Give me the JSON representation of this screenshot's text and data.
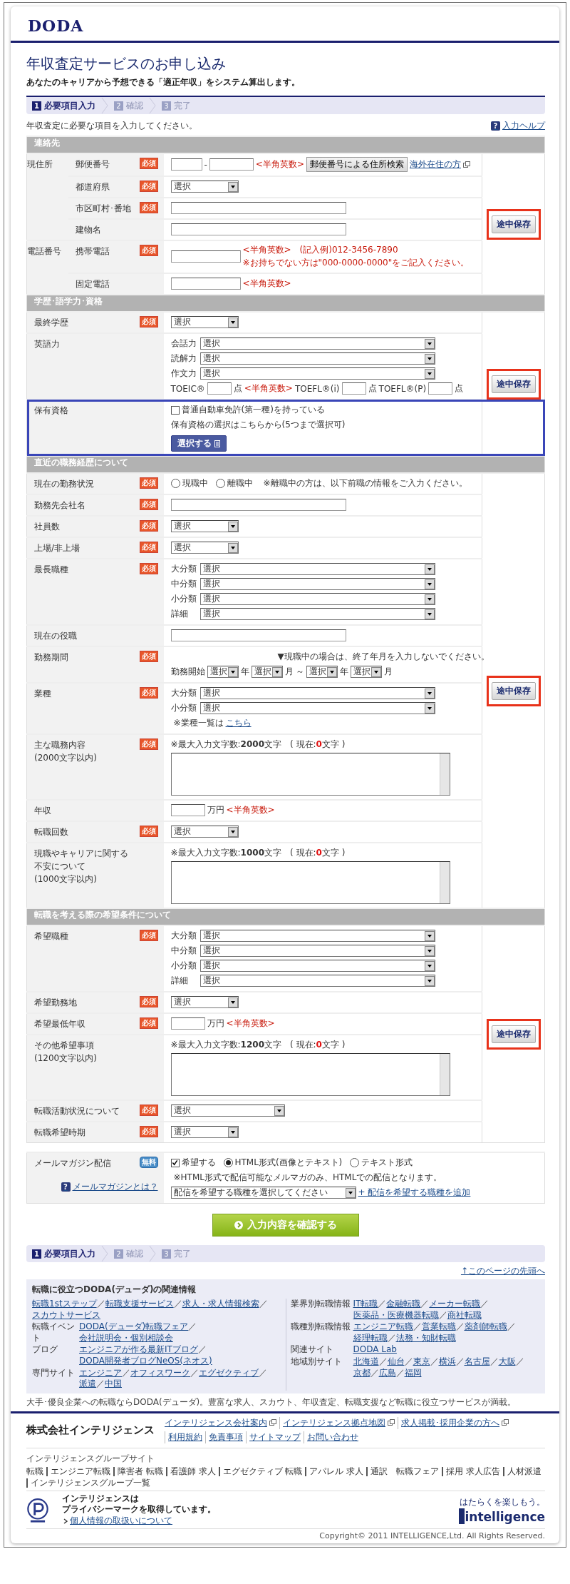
{
  "logo": "DODA",
  "title": "年収査定サービスのお申し込み",
  "subtitle": "あなたのキャリアから予想できる「適正年収」をシステム算出します。",
  "steps_top": [
    {
      "num": "1",
      "label": "必要項目入力",
      "selected": true
    },
    {
      "num": "2",
      "label": "確認",
      "selected": false
    },
    {
      "num": "3",
      "label": "完了",
      "selected": false
    }
  ],
  "intro": "年収査定に必要な項目を入力してください。",
  "help_link": {
    "icon": "?",
    "text": "入力ヘルプ"
  },
  "sections": [
    {
      "title": "連絡先",
      "save_button": "途中保存",
      "save_highlighted": true,
      "rows": [
        {
          "label": "現住所",
          "subrows": [
            {
              "label": "郵便番号",
              "badge": "必須",
              "lines": [
                {
                  "items": [
                    {
                      "kind": "input"
                    },
                    {
                      "kind": "text",
                      "text": "-"
                    },
                    {
                      "kind": "input"
                    },
                    {
                      "kind": "note",
                      "text": "<半角英数>"
                    },
                    {
                      "kind": "button",
                      "text": "郵便番号による住所検索"
                    },
                    {
                      "kind": "link",
                      "text": "海外在住の方",
                      "external": true
                    }
                  ]
                }
              ]
            },
            {
              "label": "都道府県",
              "badge": "必須",
              "lines": [
                {
                  "items": [
                    {
                      "kind": "select",
                      "value": "選択"
                    }
                  ]
                }
              ]
            },
            {
              "label": "市区町村･番地",
              "badge": "必須",
              "lines": [
                {
                  "items": [
                    {
                      "kind": "input"
                    }
                  ]
                }
              ]
            },
            {
              "label": "建物名",
              "lines": [
                {
                  "items": [
                    {
                      "kind": "input"
                    }
                  ]
                }
              ]
            }
          ]
        },
        {
          "label": "電話番号",
          "subrows": [
            {
              "label": "携帯電話",
              "badge": "必須",
              "lines": [
                {
                  "items": [
                    {
                      "kind": "input"
                    },
                    {
                      "kind": "notes",
                      "texts": [
                        "<半角英数>　(記入例)012-3456-7890",
                        "※お持ちでない方は\"000-0000-0000\"をご記入ください。"
                      ]
                    }
                  ]
                }
              ]
            },
            {
              "label": "固定電話",
              "lines": [
                {
                  "items": [
                    {
                      "kind": "input"
                    },
                    {
                      "kind": "note",
                      "text": "<半角英数>"
                    }
                  ]
                }
              ]
            }
          ]
        }
      ]
    },
    {
      "title": "学歴･語学力･資格",
      "save_button": "途中保存",
      "save_highlighted": true,
      "rows": [
        {
          "label": "最終学歴",
          "badge": "必須",
          "lines": [
            {
              "items": [
                {
                  "kind": "select",
                  "value": "選択"
                }
              ]
            }
          ]
        },
        {
          "label": "英語力",
          "lines": [
            {
              "label": "会話力",
              "items": [
                {
                  "kind": "select",
                  "value": "選択"
                }
              ]
            },
            {
              "label": "読解力",
              "items": [
                {
                  "kind": "select",
                  "value": "選択"
                }
              ]
            },
            {
              "label": "作文力",
              "items": [
                {
                  "kind": "select",
                  "value": "選択"
                }
              ]
            },
            {
              "items": [
                {
                  "kind": "text",
                  "text": "TOEIC®"
                },
                {
                  "kind": "input"
                },
                {
                  "kind": "text",
                  "text": "点"
                },
                {
                  "kind": "note",
                  "text": "<半角英数>"
                },
                {
                  "kind": "text",
                  "text": "TOEFL®(i)"
                },
                {
                  "kind": "input"
                },
                {
                  "kind": "text",
                  "text": "点"
                },
                {
                  "kind": "text",
                  "text": "TOEFL®(P)"
                },
                {
                  "kind": "input"
                },
                {
                  "kind": "text",
                  "text": "点"
                }
              ]
            }
          ]
        },
        {
          "label": "保有資格",
          "highlighted": true,
          "lines": [
            {
              "items": [
                {
                  "kind": "checkbox",
                  "text": "普通自動車免許(第一種)を持っている",
                  "checked": false
                }
              ]
            },
            {
              "items": [
                {
                  "kind": "text",
                  "text": "保有資格の選択はこちらから(5つまで選択可)"
                }
              ]
            },
            {
              "items": [
                {
                  "kind": "pick",
                  "text": "選択する"
                }
              ]
            }
          ]
        }
      ]
    },
    {
      "title": "直近の職務経歴について",
      "save_button": "途中保存",
      "save_highlighted": true,
      "rows": [
        {
          "label": "現在の勤務状況",
          "badge": "必須",
          "lines": [
            {
              "items": [
                {
                  "kind": "radio",
                  "text": "現職中",
                  "selected": false
                },
                {
                  "kind": "radio",
                  "text": "離職中",
                  "selected": false
                },
                {
                  "kind": "small",
                  "text": "※離職中の方は、以下前職の情報をご入力ください。"
                }
              ]
            }
          ]
        },
        {
          "label": "勤務先会社名",
          "badge": "必須",
          "lines": [
            {
              "items": [
                {
                  "kind": "input"
                }
              ]
            }
          ]
        },
        {
          "label": "社員数",
          "badge": "必須",
          "lines": [
            {
              "items": [
                {
                  "kind": "select",
                  "value": "選択"
                }
              ]
            }
          ]
        },
        {
          "label": "上場/非上場",
          "badge": "必須",
          "lines": [
            {
              "items": [
                {
                  "kind": "select",
                  "value": "選択"
                }
              ]
            }
          ]
        },
        {
          "label": "最長職種",
          "badge": "必須",
          "lines": [
            {
              "label": "大分類",
              "items": [
                {
                  "kind": "select",
                  "value": "選択"
                }
              ]
            },
            {
              "label": "中分類",
              "items": [
                {
                  "kind": "select",
                  "value": "選択"
                }
              ]
            },
            {
              "label": "小分類",
              "items": [
                {
                  "kind": "select",
                  "value": "選択"
                }
              ]
            },
            {
              "label": "詳細",
              "items": [
                {
                  "kind": "select",
                  "value": "選択"
                }
              ]
            }
          ]
        },
        {
          "label": "現在の役職",
          "lines": [
            {
              "items": [
                {
                  "kind": "input"
                }
              ]
            }
          ]
        },
        {
          "label": "勤務期間",
          "badge": "必須",
          "lines": [
            {
              "items": [
                {
                  "kind": "hint",
                  "text": "▼現職中の場合は、終了年月を入力しないでください。"
                }
              ]
            },
            {
              "items": [
                {
                  "kind": "text",
                  "text": "勤務開始"
                },
                {
                  "kind": "select",
                  "value": "選択"
                },
                {
                  "kind": "text",
                  "text": "年"
                },
                {
                  "kind": "select",
                  "value": "選択"
                },
                {
                  "kind": "text",
                  "text": "月"
                },
                {
                  "kind": "text",
                  "text": "～"
                },
                {
                  "kind": "select",
                  "value": "選択"
                },
                {
                  "kind": "text",
                  "text": "年"
                },
                {
                  "kind": "select",
                  "value": "選択"
                },
                {
                  "kind": "text",
                  "text": "月"
                }
              ]
            }
          ]
        },
        {
          "label": "業種",
          "badge": "必須",
          "lines": [
            {
              "label": "大分類",
              "items": [
                {
                  "kind": "select",
                  "value": "選択"
                }
              ]
            },
            {
              "label": "小分類",
              "items": [
                {
                  "kind": "select",
                  "value": "選択"
                }
              ]
            },
            {
              "items": [
                {
                  "kind": "small",
                  "text": "※業種一覧は"
                },
                {
                  "kind": "link",
                  "text": "こちら"
                }
              ]
            }
          ]
        },
        {
          "label": "主な職務内容",
          "label_note": "(2000文字以内)",
          "badge": "必須",
          "lines": [
            {
              "items": [
                {
                  "kind": "counter",
                  "parts": [
                    "※最大入力文字数:",
                    "2000",
                    "文字　( 現在:",
                    "0",
                    "文字 )"
                  ]
                }
              ]
            },
            {
              "items": [
                {
                  "kind": "textarea"
                }
              ]
            }
          ]
        },
        {
          "label": "年収",
          "lines": [
            {
              "items": [
                {
                  "kind": "input"
                },
                {
                  "kind": "text",
                  "text": "万円"
                },
                {
                  "kind": "note",
                  "text": "<半角英数>"
                }
              ]
            }
          ]
        },
        {
          "label": "転職回数",
          "badge": "必須",
          "lines": [
            {
              "items": [
                {
                  "kind": "select",
                  "value": "選択"
                }
              ]
            }
          ]
        },
        {
          "label": "現職やキャリアに関する不安について",
          "label_note": "(1000文字以内)",
          "lines": [
            {
              "items": [
                {
                  "kind": "counter",
                  "parts": [
                    "※最大入力文字数:",
                    "1000",
                    "文字　( 現在:",
                    "0",
                    "文字 )"
                  ]
                }
              ]
            },
            {
              "items": [
                {
                  "kind": "textarea"
                }
              ]
            }
          ]
        }
      ]
    },
    {
      "title": "転職を考える際の希望条件について",
      "save_button": "途中保存",
      "save_highlighted": true,
      "rows": [
        {
          "label": "希望職種",
          "badge": "必須",
          "lines": [
            {
              "label": "大分類",
              "items": [
                {
                  "kind": "select",
                  "value": "選択"
                }
              ]
            },
            {
              "label": "中分類",
              "items": [
                {
                  "kind": "select",
                  "value": "選択"
                }
              ]
            },
            {
              "label": "小分類",
              "items": [
                {
                  "kind": "select",
                  "value": "選択"
                }
              ]
            },
            {
              "label": "詳細",
              "items": [
                {
                  "kind": "select",
                  "value": "選択"
                }
              ]
            }
          ]
        },
        {
          "label": "希望勤務地",
          "badge": "必須",
          "lines": [
            {
              "items": [
                {
                  "kind": "select",
                  "value": "選択"
                }
              ]
            }
          ]
        },
        {
          "label": "希望最低年収",
          "badge": "必須",
          "lines": [
            {
              "items": [
                {
                  "kind": "input"
                },
                {
                  "kind": "text",
                  "text": "万円"
                },
                {
                  "kind": "note",
                  "text": "<半角英数>"
                }
              ]
            }
          ]
        },
        {
          "label": "その他希望事項",
          "label_note": "(1200文字以内)",
          "lines": [
            {
              "items": [
                {
                  "kind": "counter",
                  "parts": [
                    "※最大入力文字数:",
                    "1200",
                    "文字　( 現在:",
                    "0",
                    "文字 )"
                  ]
                }
              ]
            },
            {
              "items": [
                {
                  "kind": "textarea"
                }
              ]
            }
          ]
        },
        {
          "label": "転職活動状況について",
          "badge": "必須",
          "lines": [
            {
              "items": [
                {
                  "kind": "select",
                  "value": "選択"
                },
                {
                  "kind": "gap"
                }
              ]
            }
          ]
        },
        {
          "label": "転職希望時期",
          "badge": "必須",
          "lines": [
            {
              "items": [
                {
                  "kind": "select",
                  "value": "選択"
                }
              ]
            }
          ]
        }
      ]
    }
  ],
  "mail_magazine": {
    "label": "メールマガジン配信",
    "badge": "無料",
    "help_link": {
      "icon": "?",
      "text": "メールマガジンとは？"
    },
    "lines": [
      {
        "items": [
          {
            "kind": "checkbox",
            "text": "希望する",
            "checked": true
          },
          {
            "kind": "radio",
            "text": "HTML形式(画像とテキスト)",
            "selected": true
          },
          {
            "kind": "radio",
            "text": "テキスト形式",
            "selected": false
          }
        ]
      },
      {
        "items": [
          {
            "kind": "small",
            "text": "※HTML形式で配信可能なメルマガのみ、HTMLでの配信となります。"
          }
        ]
      },
      {
        "items": [
          {
            "kind": "select",
            "value": "配信を希望する職種を選択してください"
          },
          {
            "kind": "link",
            "text": "+ 配信を希望する職種を追加"
          }
        ]
      }
    ]
  },
  "confirm_button": "入力内容を確認する",
  "steps_bottom": [
    {
      "num": "1",
      "label": "必要項目入力",
      "selected": true
    },
    {
      "num": "2",
      "label": "確認",
      "selected": false
    },
    {
      "num": "3",
      "label": "完了",
      "selected": false
    }
  ],
  "page_top_link": "↑このページの先頭へ",
  "related": {
    "title": "転職に役立つDODA(デューダ)の関連情報",
    "separator": "／",
    "columns": [
      [
        {
          "links": [
            "転職1stステップ",
            "転職支援サービス",
            "求人・求人情報検索",
            "スカウトサービス"
          ]
        },
        {
          "label": "転職イベント",
          "links": [
            "DODA(デューダ)転職フェア",
            "会社説明会・個別相談会"
          ]
        },
        {
          "label": "ブログ",
          "links": [
            "エンジニアが作る最新ITブログ",
            "DODA開発者ブログNeOS(ネオス)"
          ]
        },
        {
          "label": "専門サイト",
          "links": [
            "エンジニア",
            "オフィスワーク",
            "エグゼクティブ",
            "派遣",
            "中国"
          ]
        }
      ],
      [
        {
          "label": "業界別転職情報",
          "links": [
            "IT転職",
            "金融転職",
            "メーカー転職",
            "医薬品・医療機器転職",
            "商社転職"
          ]
        },
        {
          "label": "職種別転職情報",
          "links": [
            "エンジニア転職",
            "営業転職",
            "薬剤師転職",
            "経理転職",
            "法務・知財転職"
          ]
        },
        {
          "label": "関連サイト",
          "links": [
            "DODA Lab"
          ]
        },
        {
          "label": "地域別サイト",
          "links": [
            "北海道",
            "仙台",
            "東京",
            "横浜",
            "名古屋",
            "大阪",
            "京都",
            "広島",
            "福岡"
          ]
        }
      ]
    ]
  },
  "tagline": "大手･優良企業への転職ならDODA(デューダ)。豊富な求人、スカウト、年収査定、転職支援など転職に役立つサービスが満載。",
  "footer": {
    "company": "株式会社インテリジェンス",
    "links": [
      {
        "text": "インテリジェンス会社案内",
        "external": true
      },
      {
        "text": "インテリジェンス拠点地図",
        "external": true
      },
      {
        "text": "求人掲載･採用企業の方へ",
        "external": true
      },
      {
        "text": "利用規約",
        "external": false
      },
      {
        "text": "免責事項",
        "external": false
      },
      {
        "text": "サイトマップ",
        "external": false
      },
      {
        "text": "お問い合わせ",
        "external": false
      }
    ],
    "group_title": "インテリジェンスグループサイト",
    "group_links": [
      "転職",
      "エンジニア転職",
      "障害者 転職",
      "看護師 求人",
      "エグゼクティブ 転職",
      "アパレル 求人",
      "通訳　転職フェア",
      "採用 求人広告",
      "人材派遣",
      "インテリジェンスグループ一覧"
    ],
    "privacy_lines": [
      "インテリジェンスは",
      "プライバシーマークを取得しています。"
    ],
    "privacy_link": "個人情報の取扱いについて",
    "brand_tagline": "はたらくを楽しもう。",
    "brand": "intelligence",
    "copyright": "Copyright© 2011 INTELLIGENCE,Ltd. All Rights Reserved."
  }
}
